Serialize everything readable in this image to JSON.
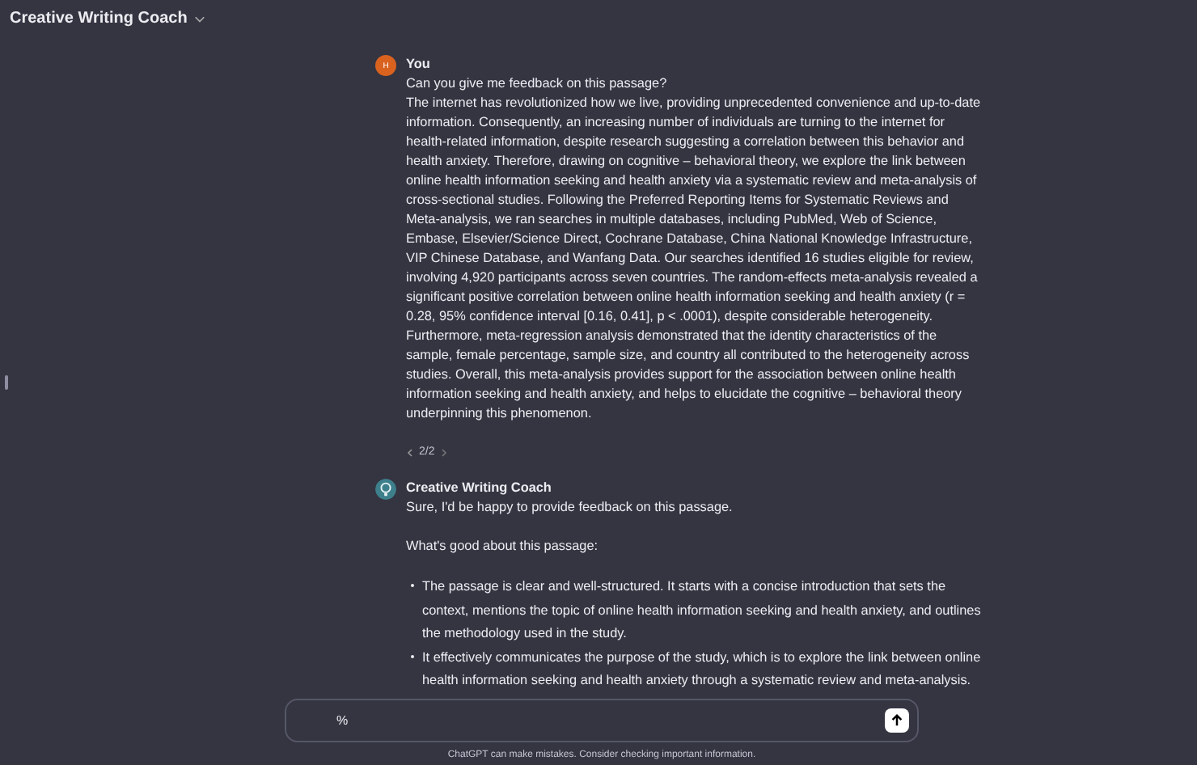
{
  "header": {
    "title": "Creative Writing Coach"
  },
  "messages": [
    {
      "kind": "user",
      "avatar": "H",
      "author": "You",
      "paragraphs": [
        "Can you give me feedback on this passage?",
        "The internet has revolutionized how we live, providing unprecedented convenience and up-to-date information. Consequently, an increasing number of individuals are turning to the internet for health-related information, despite research suggesting a correlation between this behavior and health anxiety. Therefore, drawing on cognitive – behavioral theory, we explore the link between online health information seeking and health anxiety via a systematic review and meta-analysis of cross-sectional studies. Following the Preferred Reporting Items for Systematic Reviews and Meta-analysis, we ran searches in multiple databases, including PubMed, Web of Science, Embase, Elsevier/Science Direct, Cochrane Database, China National Knowledge Infrastructure, VIP Chinese Database, and Wanfang Data. Our searches identified 16 studies eligible for review, involving 4,920 participants across seven countries. The random-effects meta-analysis revealed a significant positive correlation between online health information seeking and health anxiety (r = 0.28, 95% confidence interval [0.16, 0.41], p < .0001), despite considerable heterogeneity. Furthermore, meta-regression analysis demonstrated that the identity characteristics of the sample, female percentage, sample size, and country all contributed to the heterogeneity across studies. Overall, this meta-analysis provides support for the association between online health information seeking and health anxiety, and helps to elucidate the cognitive – behavioral theory underpinning this phenomenon."
      ],
      "pager": "2/2"
    },
    {
      "kind": "assistant",
      "author": "Creative Writing Coach",
      "paragraphs": [
        "Sure, I'd be happy to provide feedback on this passage.",
        "What's good about this passage:"
      ],
      "bullets": [
        "The passage is clear and well-structured. It starts with a concise introduction that sets the context, mentions the topic of online health information seeking and health anxiety, and outlines the methodology used in the study.",
        "It effectively communicates the purpose of the study, which is to explore the link between online health information seeking and health anxiety through a systematic review and meta-analysis."
      ]
    }
  ],
  "composer": {
    "value": "%"
  },
  "footer": "ChatGPT can make mistakes. Consider checking important information."
}
